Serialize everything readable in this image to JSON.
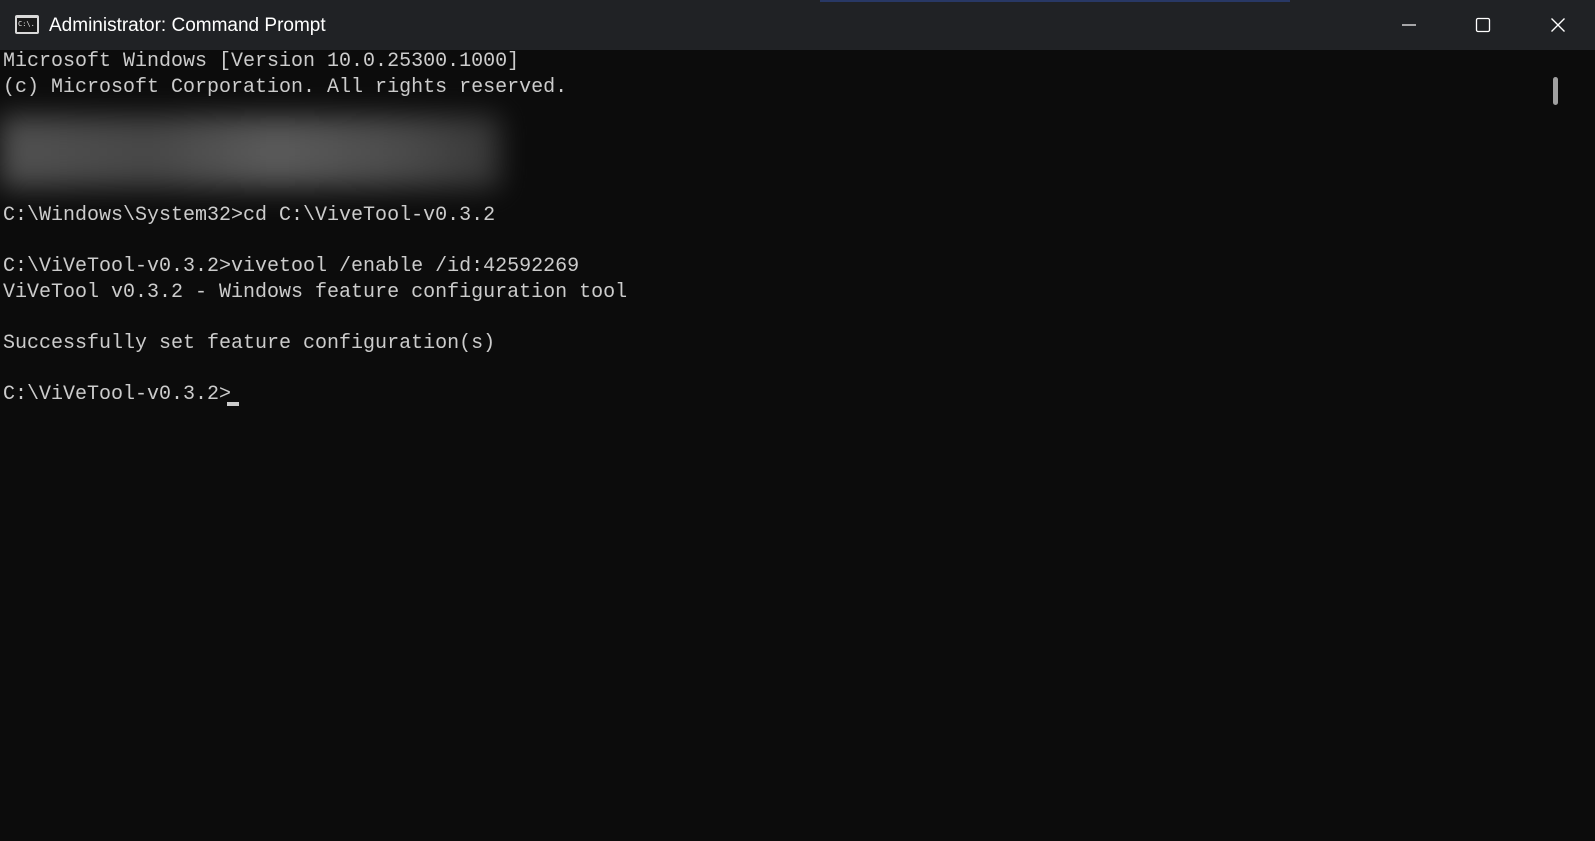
{
  "window": {
    "title": "Administrator: Command Prompt",
    "icon": "command-prompt-icon",
    "icon_text": "C:\\.",
    "controls": {
      "minimize": "minimize-icon",
      "maximize": "maximize-icon",
      "close": "close-icon"
    }
  },
  "console": {
    "lines": [
      "Microsoft Windows [Version 10.0.25300.1000]",
      "(c) Microsoft Corporation. All rights reserved.",
      "C:\\Windows\\System32>cd C:\\ViveTool-v0.3.2",
      "C:\\ViVeTool-v0.3.2>vivetool /enable /id:42592269",
      "ViVeTool v0.3.2 - Windows feature configuration tool",
      "Successfully set feature configuration(s)",
      "C:\\ViVeTool-v0.3.2>"
    ]
  },
  "colors": {
    "background": "#0c0c0c",
    "titlebar": "#202225",
    "text": "#cccccc",
    "title_text": "#ffffff"
  }
}
